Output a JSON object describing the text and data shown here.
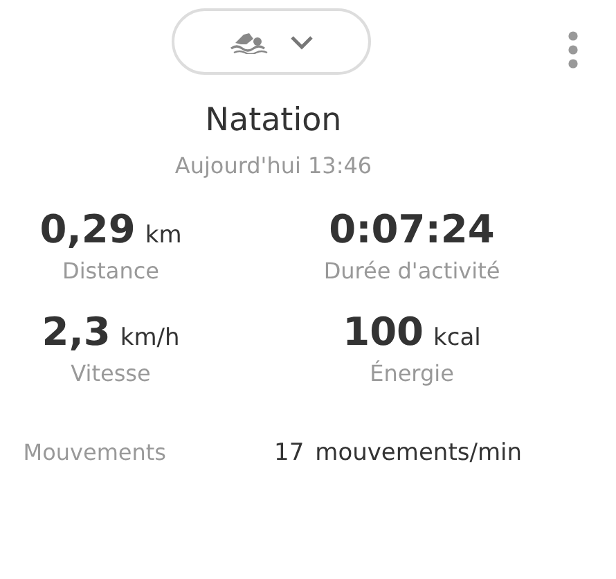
{
  "activity_selector": {
    "expanded": false
  },
  "title": "Natation",
  "date": "Aujourd'hui 13:46",
  "stats": [
    {
      "value": "0,29",
      "unit": "km",
      "label": "Distance"
    },
    {
      "value": "0:07:24",
      "label": "Durée d'activité"
    },
    {
      "value": "2,3",
      "unit": "km/h",
      "label": "Vitesse"
    },
    {
      "value": "100",
      "unit": "kcal",
      "label": "Énergie"
    }
  ],
  "detail_row": {
    "label": "Mouvements",
    "value": "17",
    "unit": "mouvements/min"
  }
}
